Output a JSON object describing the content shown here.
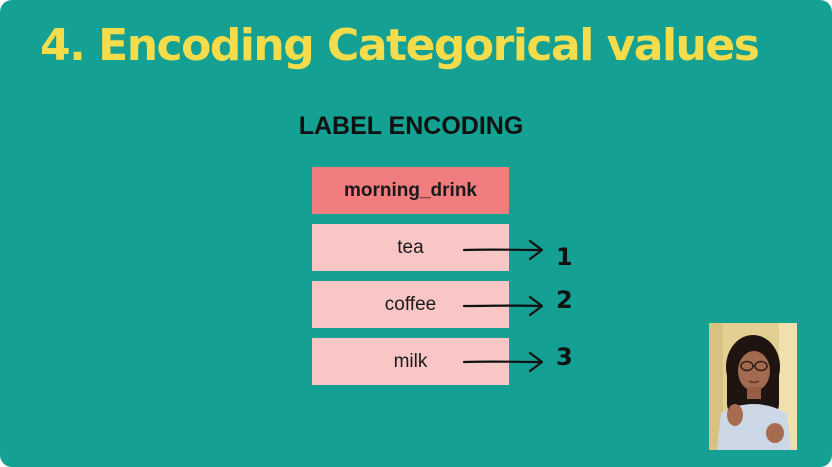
{
  "slide": {
    "title": "4. Encoding Categorical values",
    "subtitle": "LABEL ENCODING",
    "table": {
      "header": "morning_drink",
      "rows": [
        {
          "value": "tea",
          "code": "1"
        },
        {
          "value": "coffee",
          "code": "2"
        },
        {
          "value": "milk",
          "code": "3"
        }
      ]
    }
  },
  "colors": {
    "background": "#14a092",
    "title": "#f3dd4c",
    "header_cell": "#f27d7f",
    "value_cell": "#f9c6c6"
  },
  "icons": {
    "arrow": "right-arrow-icon",
    "webcam": "presenter-webcam"
  }
}
